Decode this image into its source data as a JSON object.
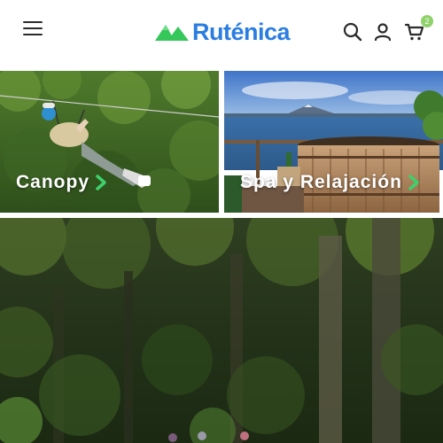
{
  "header": {
    "logo_text": "Ruténica",
    "cart_count": "2",
    "icons": [
      "menu-icon",
      "search-icon",
      "user-icon",
      "cart-icon"
    ]
  },
  "categories": [
    {
      "label": "Canopy"
    },
    {
      "label": "Spa y Relajación"
    }
  ],
  "colors": {
    "brand_blue": "#2a7de1",
    "brand_green": "#35c759",
    "badge_green": "#8fd16a"
  }
}
